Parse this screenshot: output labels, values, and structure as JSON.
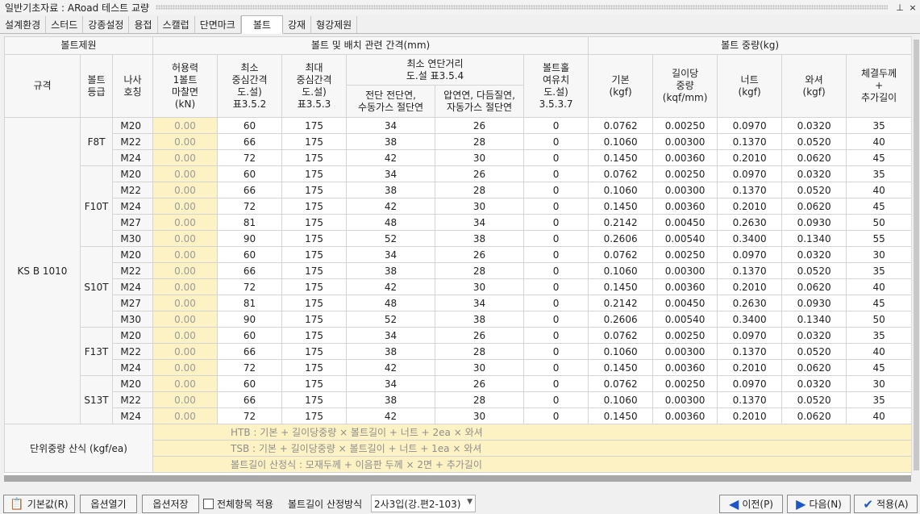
{
  "window": {
    "title": "일반기초자료 : ARoad 테스트 교량",
    "pin_icon": "pin-icon",
    "close_icon": "close-icon"
  },
  "tabs": [
    {
      "label": "설계환경"
    },
    {
      "label": "스터드"
    },
    {
      "label": "강종설정"
    },
    {
      "label": "용접"
    },
    {
      "label": "스캘럽"
    },
    {
      "label": "단면마크"
    },
    {
      "label": "볼트",
      "active": true
    },
    {
      "label": "강재"
    },
    {
      "label": "형강제원"
    }
  ],
  "table": {
    "group_headers": {
      "bolt_spec": "볼트제원",
      "spacing": "볼트 및 배치 관련 간격(mm)",
      "weight": "볼트 중량(kg)"
    },
    "headers": {
      "standard": "규격",
      "grade": "볼트\n등급",
      "thread": "나사\n호칭",
      "allowable": "허용력\n1볼트\n마찰면\n(kN)",
      "min_pitch": "최소\n중심간격\n도.설)\n표3.5.2",
      "max_pitch": "최대\n중심간격\n도.설)\n표3.5.3",
      "min_edge": "최소 연단거리\n도.설 표3.5.4",
      "edge_shear": "전단 전단연,\n수동가스 절단연",
      "edge_rolled": "압연연, 다듬질연,\n자동가스 절단연",
      "hole_margin": "볼트홀\n여유치\n도.설)\n3.5.3.7",
      "base": "기본\n(kgf)",
      "per_length": "길이당\n중량\n(kqf/mm)",
      "nut": "너트\n(kgf)",
      "washer": "와셔\n(kgf)",
      "extra_length": "체결두께\n+\n추가길이"
    },
    "standard": "KS B 1010",
    "groups": [
      {
        "grade": "F8T",
        "rows": [
          [
            "M20",
            "0.00",
            "60",
            "175",
            "34",
            "26",
            "0",
            "0.0762",
            "0.00250",
            "0.0970",
            "0.0320",
            "35"
          ],
          [
            "M22",
            "0.00",
            "66",
            "175",
            "38",
            "28",
            "0",
            "0.1060",
            "0.00300",
            "0.1370",
            "0.0520",
            "40"
          ],
          [
            "M24",
            "0.00",
            "72",
            "175",
            "42",
            "30",
            "0",
            "0.1450",
            "0.00360",
            "0.2010",
            "0.0620",
            "45"
          ]
        ]
      },
      {
        "grade": "F10T",
        "rows": [
          [
            "M20",
            "0.00",
            "60",
            "175",
            "34",
            "26",
            "0",
            "0.0762",
            "0.00250",
            "0.0970",
            "0.0320",
            "35"
          ],
          [
            "M22",
            "0.00",
            "66",
            "175",
            "38",
            "28",
            "0",
            "0.1060",
            "0.00300",
            "0.1370",
            "0.0520",
            "40"
          ],
          [
            "M24",
            "0.00",
            "72",
            "175",
            "42",
            "30",
            "0",
            "0.1450",
            "0.00360",
            "0.2010",
            "0.0620",
            "45"
          ],
          [
            "M27",
            "0.00",
            "81",
            "175",
            "48",
            "34",
            "0",
            "0.2142",
            "0.00450",
            "0.2630",
            "0.0930",
            "50"
          ],
          [
            "M30",
            "0.00",
            "90",
            "175",
            "52",
            "38",
            "0",
            "0.2606",
            "0.00540",
            "0.3400",
            "0.1340",
            "55"
          ]
        ]
      },
      {
        "grade": "S10T",
        "rows": [
          [
            "M20",
            "0.00",
            "60",
            "175",
            "34",
            "26",
            "0",
            "0.0762",
            "0.00250",
            "0.0970",
            "0.0320",
            "30"
          ],
          [
            "M22",
            "0.00",
            "66",
            "175",
            "38",
            "28",
            "0",
            "0.1060",
            "0.00300",
            "0.1370",
            "0.0520",
            "35"
          ],
          [
            "M24",
            "0.00",
            "72",
            "175",
            "42",
            "30",
            "0",
            "0.1450",
            "0.00360",
            "0.2010",
            "0.0620",
            "40"
          ],
          [
            "M27",
            "0.00",
            "81",
            "175",
            "48",
            "34",
            "0",
            "0.2142",
            "0.00450",
            "0.2630",
            "0.0930",
            "45"
          ],
          [
            "M30",
            "0.00",
            "90",
            "175",
            "52",
            "38",
            "0",
            "0.2606",
            "0.00540",
            "0.3400",
            "0.1340",
            "50"
          ]
        ]
      },
      {
        "grade": "F13T",
        "rows": [
          [
            "M20",
            "0.00",
            "60",
            "175",
            "34",
            "26",
            "0",
            "0.0762",
            "0.00250",
            "0.0970",
            "0.0320",
            "35"
          ],
          [
            "M22",
            "0.00",
            "66",
            "175",
            "38",
            "28",
            "0",
            "0.1060",
            "0.00300",
            "0.1370",
            "0.0520",
            "40"
          ],
          [
            "M24",
            "0.00",
            "72",
            "175",
            "42",
            "30",
            "0",
            "0.1450",
            "0.00360",
            "0.2010",
            "0.0620",
            "45"
          ]
        ]
      },
      {
        "grade": "S13T",
        "rows": [
          [
            "M20",
            "0.00",
            "60",
            "175",
            "34",
            "26",
            "0",
            "0.0762",
            "0.00250",
            "0.0970",
            "0.0320",
            "30"
          ],
          [
            "M22",
            "0.00",
            "66",
            "175",
            "38",
            "28",
            "0",
            "0.1060",
            "0.00300",
            "0.1370",
            "0.0520",
            "35"
          ],
          [
            "M24",
            "0.00",
            "72",
            "175",
            "42",
            "30",
            "0",
            "0.1450",
            "0.00360",
            "0.2010",
            "0.0620",
            "40"
          ]
        ]
      }
    ],
    "formula_label": "단위중량 산식 (kgf/ea)",
    "formulas": [
      "HTB : 기본 + 길이당중량 × 볼트길이 + 너트 + 2ea × 와셔",
      "TSB : 기본 + 길이당중량 × 볼트길이 + 너트 + 1ea × 와셔",
      "볼트길이 산정식 : 모재두께 + 이음판 두께 × 2면 + 추가길이"
    ]
  },
  "bottom": {
    "default_button": "기본값(R)",
    "default_icon": "clipboard-icon",
    "open_option": "옵션열기",
    "save_option": "옵션저장",
    "apply_all_label": "전체항목 적용",
    "bolt_length_label": "볼트길이 산정방식",
    "bolt_length_value": "2사3입(강.편2-103)",
    "prev_button": "이전(P)",
    "next_button": "다음(N)",
    "apply_button": "적용(A)",
    "colors": {
      "accent_blue": "#1e56c8",
      "edit_cell": "#fdf2c4"
    }
  }
}
